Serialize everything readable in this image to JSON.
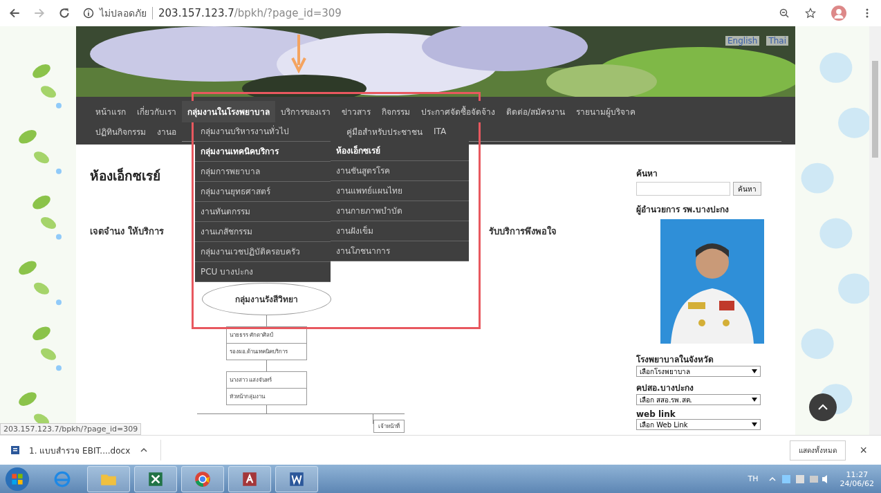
{
  "browser": {
    "security_label": "ไม่ปลอดภัย",
    "url_host": "203.157.123.7",
    "url_path": "/bpkh/?page_id=309",
    "status_url": "203.157.123.7/bpkh/?page_id=309"
  },
  "banner": {
    "languages": [
      {
        "label": "English"
      },
      {
        "label": "Thai"
      }
    ]
  },
  "nav": {
    "items": [
      {
        "label": "หน้าแรก",
        "selected": false
      },
      {
        "label": "เกี่ยวกับเรา",
        "selected": false
      },
      {
        "label": "กลุ่มงานในโรงพยาบาล",
        "selected": true
      },
      {
        "label": "บริการของเรา",
        "selected": false
      },
      {
        "label": "ข่าวสาร",
        "selected": false
      },
      {
        "label": "กิจกรรม",
        "selected": false
      },
      {
        "label": "ประกาศจัดซื้อจัดจ้าง",
        "selected": false
      },
      {
        "label": "ติดต่อ/สมัครงาน",
        "selected": false
      },
      {
        "label": "รายนามผู้บริจาค",
        "selected": false
      }
    ],
    "more_items": [
      {
        "label": "ปฏิทินกิจกรรม",
        "selected": false
      },
      {
        "label": "งานอ",
        "selected": false
      },
      {
        "label": "คู่มือสำหรับประชาชน",
        "selected": false
      },
      {
        "label": "ITA",
        "selected": false
      }
    ],
    "dropdown": [
      {
        "label": "กลุ่มงานบริหารงานทั่วไป",
        "selected": false
      },
      {
        "label": "กลุ่มงานเทคนิคบริการ",
        "selected": true
      },
      {
        "label": "กลุ่มการพยาบาล",
        "selected": false
      },
      {
        "label": "กลุ่มงานยุทธศาสตร์",
        "selected": false
      },
      {
        "label": "งานทันตกรรม",
        "selected": false
      },
      {
        "label": "งานเภสัชกรรม",
        "selected": false
      },
      {
        "label": "กลุ่มงานเวชปฏิบัติครอบครัว",
        "selected": false
      },
      {
        "label": "PCU บางปะกง",
        "selected": false
      }
    ],
    "submenu": [
      {
        "label": "ห้องเอ็กซเรย์",
        "selected": true
      },
      {
        "label": "งานชันสูตรโรค",
        "selected": false
      },
      {
        "label": "งานแพทย์แผนไทย",
        "selected": false
      },
      {
        "label": "งานกายภาพบำบัด",
        "selected": false
      },
      {
        "label": "งานฝังเข็ม",
        "selected": false
      },
      {
        "label": "งานโภชนาการ",
        "selected": false
      }
    ]
  },
  "main": {
    "heading": "ห้องเอ็กซเรย์",
    "paragraph_parts": [
      "เจตจำนง  ให้บริการ",
      "รับบริการพึงพอใจ"
    ],
    "org_chart": {
      "top_node": "กลุ่มงานรังสีวิทยา",
      "boxes": [
        {
          "lines": [
            "นายธรร ศักดาศิลป์",
            "รองผอ.ด้านเทคนิคบริการ"
          ]
        },
        {
          "lines": [
            "นางสาว แสงจันทร์",
            "หัวหน้ากลุ่มงาน"
          ]
        }
      ],
      "bottom_node": "เจ้าหน้าที่"
    }
  },
  "sidebar": {
    "search_title": "ค้นหา",
    "search_button": "ค้นหา",
    "director_title": "ผู้อำนวยการ รพ.บางปะกง",
    "selects": [
      {
        "title": "โรงพยาบาลในจังหวัด",
        "value": "เลือกโรงพยาบาล"
      },
      {
        "title": "คปสอ.บางปะกง",
        "value": "เลือก สสอ.รพ.สต."
      },
      {
        "title": "web link",
        "value": "เลือก Web Link"
      }
    ]
  },
  "downloads": {
    "file": "1. แบบสำรวจ EBIT....docx",
    "show_all": "แสดงทั้งหมด",
    "close": "×"
  },
  "taskbar": {
    "language": "TH",
    "time": "11:27",
    "date": "24/06/62"
  }
}
